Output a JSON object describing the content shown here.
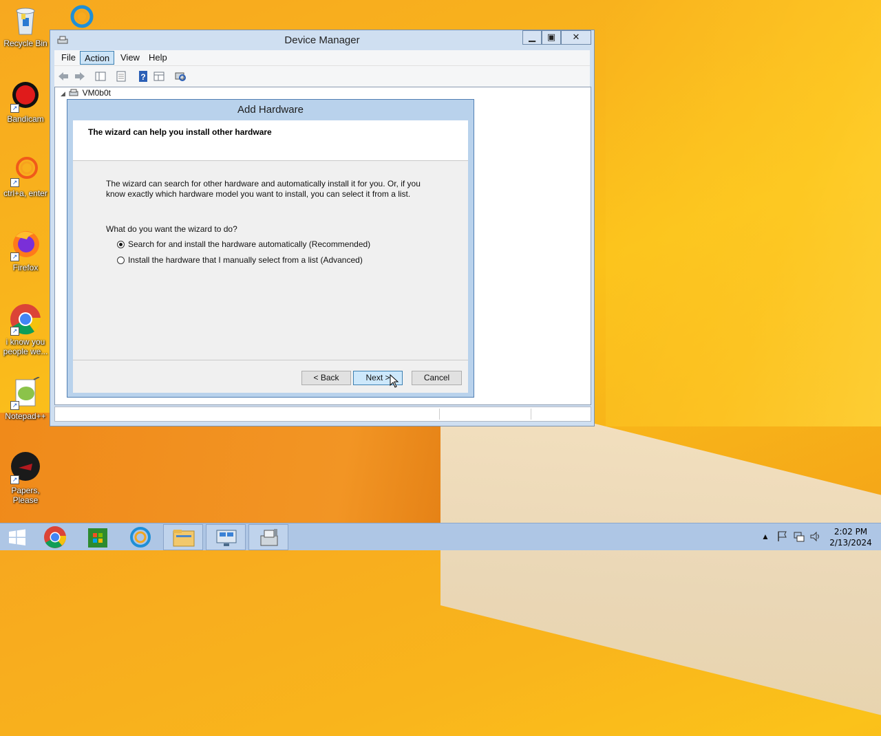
{
  "desktop": {
    "icons": [
      {
        "label": "Recycle Bin",
        "icon": "recycle-bin-icon"
      },
      {
        "label": "Bandicam",
        "icon": "bandicam-icon"
      },
      {
        "label": "ctrl+a, enter",
        "icon": "search-ring-icon"
      },
      {
        "label": "Firefox",
        "icon": "firefox-icon"
      },
      {
        "label": "i know you people we...",
        "icon": "chrome-icon"
      },
      {
        "label": "Notepad++",
        "icon": "notepadpp-icon"
      },
      {
        "label": "Papers, Please",
        "icon": "papers-please-icon"
      }
    ]
  },
  "device_manager": {
    "title": "Device Manager",
    "menu": [
      "File",
      "Action",
      "View",
      "Help"
    ],
    "active_menu": "Action",
    "tree_root": "VM0b0t",
    "toolbar_icons": [
      "back-arrow-icon",
      "forward-arrow-icon",
      "show-hide-tree-icon",
      "properties-icon",
      "help-icon",
      "details-pane-icon",
      "scan-hardware-icon"
    ]
  },
  "add_hardware": {
    "title": "Add Hardware",
    "heading": "The wizard can help you install other hardware",
    "intro_line1": "The wizard can search for other hardware and automatically install it for you. Or, if you",
    "intro_line2": "know exactly which hardware model you want to install, you can select it from a list.",
    "question": "What do you want the wizard to do?",
    "options": [
      {
        "label": "Search for and install the hardware automatically (Recommended)",
        "checked": true
      },
      {
        "label": "Install the hardware that I manually select from a list (Advanced)",
        "checked": false
      }
    ],
    "buttons": {
      "back": "< Back",
      "next": "Next >",
      "cancel": "Cancel"
    }
  },
  "taskbar": {
    "apps": [
      "start-icon",
      "chrome-icon",
      "store-icon",
      "search-ring-icon",
      "file-explorer-icon",
      "remote-desktop-icon",
      "device-manager-icon"
    ],
    "time": "2:02 PM",
    "date": "2/13/2024"
  }
}
